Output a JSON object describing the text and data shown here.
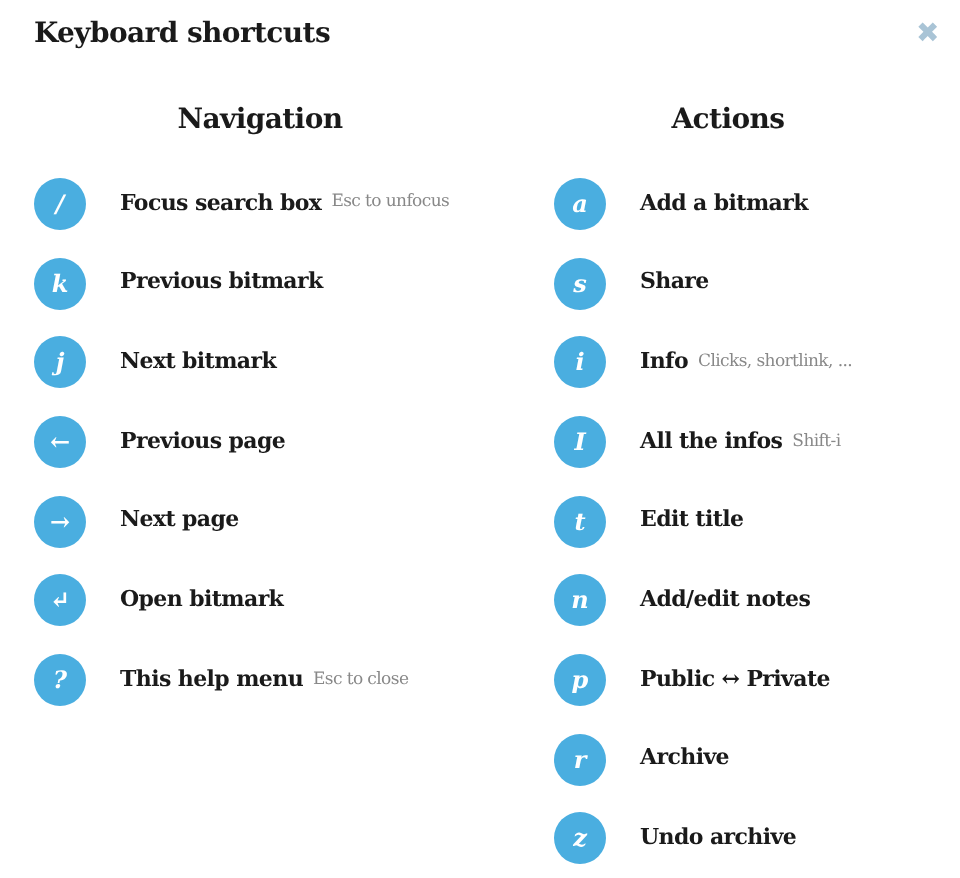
{
  "title": "Keyboard shortcuts",
  "close": "✖",
  "sections": [
    {
      "heading": "Navigation",
      "shortcuts": [
        {
          "key": "/",
          "label": "Focus search box",
          "hint": "Esc to unfocus"
        },
        {
          "key": "k",
          "label": "Previous bitmark"
        },
        {
          "key": "j",
          "label": "Next bitmark"
        },
        {
          "key": "←",
          "label": "Previous page"
        },
        {
          "key": "→",
          "label": "Next page"
        },
        {
          "key": "↵",
          "label": "Open bitmark"
        },
        {
          "key": "?",
          "label": "This help menu",
          "hint": "Esc to close"
        }
      ]
    },
    {
      "heading": "Actions",
      "shortcuts": [
        {
          "key": "a",
          "label": "Add a bitmark"
        },
        {
          "key": "s",
          "label": "Share"
        },
        {
          "key": "i",
          "label": "Info",
          "hint": "Clicks, shortlink, ..."
        },
        {
          "key": "I",
          "label": "All the infos",
          "hint": "Shift-i"
        },
        {
          "key": "t",
          "label": "Edit title"
        },
        {
          "key": "n",
          "label": "Add/edit notes"
        },
        {
          "key": "p",
          "label": "Public ↔ Private"
        },
        {
          "key": "r",
          "label": "Archive"
        },
        {
          "key": "z",
          "label": "Undo archive"
        }
      ]
    }
  ]
}
